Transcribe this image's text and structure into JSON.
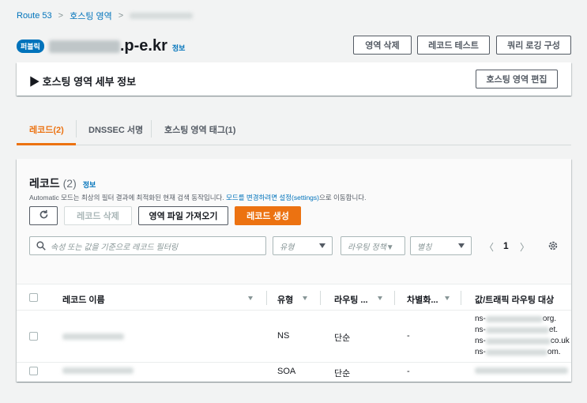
{
  "breadcrumb": {
    "root": "Route 53",
    "hosted_zones": "호스팅 영역",
    "separator": ">"
  },
  "header": {
    "badge": "퍼블릭",
    "zone_suffix": ".p-e.kr",
    "info": "정보",
    "actions": {
      "delete_zone": "영역 삭제",
      "test_record": "레코드 테스트",
      "query_logging": "쿼리 로깅 구성"
    }
  },
  "details": {
    "title": "▶ 호스팅 영역 세부 정보",
    "edit": "호스팅 영역 편집"
  },
  "tabs": [
    {
      "label": "레코드(2)",
      "active": true
    },
    {
      "label": "DNSSEC 서명",
      "active": false
    },
    {
      "label": "호스팅 영역 태그(1)",
      "active": false
    }
  ],
  "records": {
    "title": "레코드",
    "count": "(2)",
    "info": "정보",
    "desc_text": "Automatic 모드는 최상의 필터 결과에 최적화된 현재 검색 동작입니다.",
    "desc_link": "모드를 변경하려면 설정(settings)",
    "desc_suffix": "으로 이동합니다.",
    "buttons": {
      "delete": "레코드 삭제",
      "import": "영역 파일 가져오기",
      "create": "레코드 생성"
    },
    "filter": {
      "search_placeholder": "속성 또는 값을 기준으로 레코드 필터링",
      "type_placeholder": "유형",
      "routing_placeholder": "라우팅 정책▼",
      "alias_placeholder": "별칭"
    },
    "pagination": {
      "prev": "〈",
      "page": "1",
      "next": "〉"
    },
    "columns": [
      "레코드 이름",
      "유형",
      "라우팅 ...",
      "차별화...",
      "값/트래픽 라우팅 대상"
    ],
    "rows": [
      {
        "type": "NS",
        "routing": "단순",
        "diff": "-",
        "values": [
          "ns-",
          "ns-",
          "ns-",
          "ns-"
        ],
        "value_suffixes": [
          "org.",
          "et.",
          "co.uk",
          "om."
        ]
      },
      {
        "type": "SOA",
        "routing": "단순",
        "diff": "-"
      }
    ]
  },
  "colors": {
    "accent": "#ec7211",
    "link": "#0073bb",
    "badge": "#0073bb"
  },
  "icons": [
    "refresh-icon",
    "search-icon",
    "gear-icon",
    "caret-down-icon",
    "sort-icon"
  ]
}
